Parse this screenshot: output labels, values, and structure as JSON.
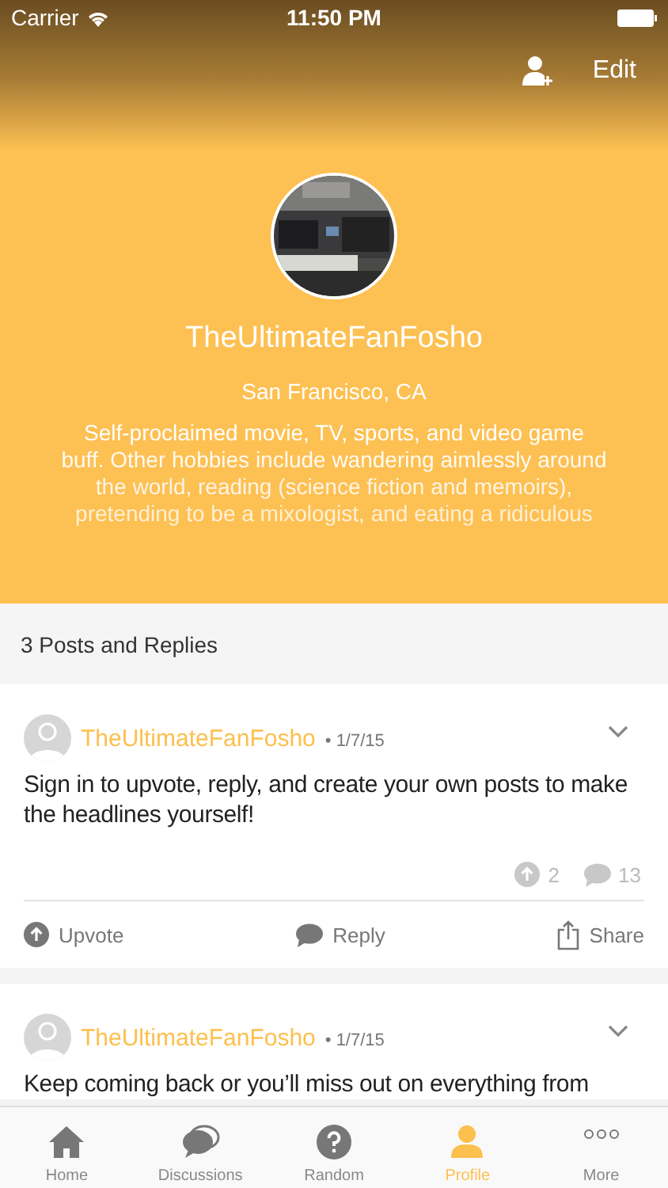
{
  "status_bar": {
    "carrier": "Carrier",
    "time": "11:50 PM"
  },
  "nav": {
    "edit": "Edit"
  },
  "profile": {
    "name": "TheUltimateFanFosho",
    "location": "San Francisco, CA",
    "bio_lines": [
      "Self-proclaimed movie, TV, sports, and video game",
      "buff. Other hobbies include wandering aimlessly around",
      "the world, reading (science fiction and memoirs),",
      "pretending to be a mixologist, and eating a ridiculous"
    ]
  },
  "section_title": "3 Posts and Replies",
  "posts": [
    {
      "author": "TheUltimateFanFosho",
      "date": "• 1/7/15",
      "text": "Sign in to upvote, reply, and create your own posts to make the headlines yourself!",
      "upvotes": "2",
      "replies": "13",
      "actions": {
        "upvote": "Upvote",
        "reply": "Reply",
        "share": "Share"
      }
    },
    {
      "author": "TheUltimateFanFosho",
      "date": "• 1/7/15",
      "text": "Keep coming back or you’ll miss out on everything from"
    }
  ],
  "tabs": [
    {
      "kind": "home",
      "label": "Home",
      "selected": false
    },
    {
      "kind": "discussions",
      "label": "Discussions",
      "selected": false
    },
    {
      "kind": "random",
      "label": "Random",
      "selected": false
    },
    {
      "kind": "profile",
      "label": "Profile",
      "selected": true
    },
    {
      "kind": "more",
      "label": "More",
      "selected": false
    }
  ]
}
